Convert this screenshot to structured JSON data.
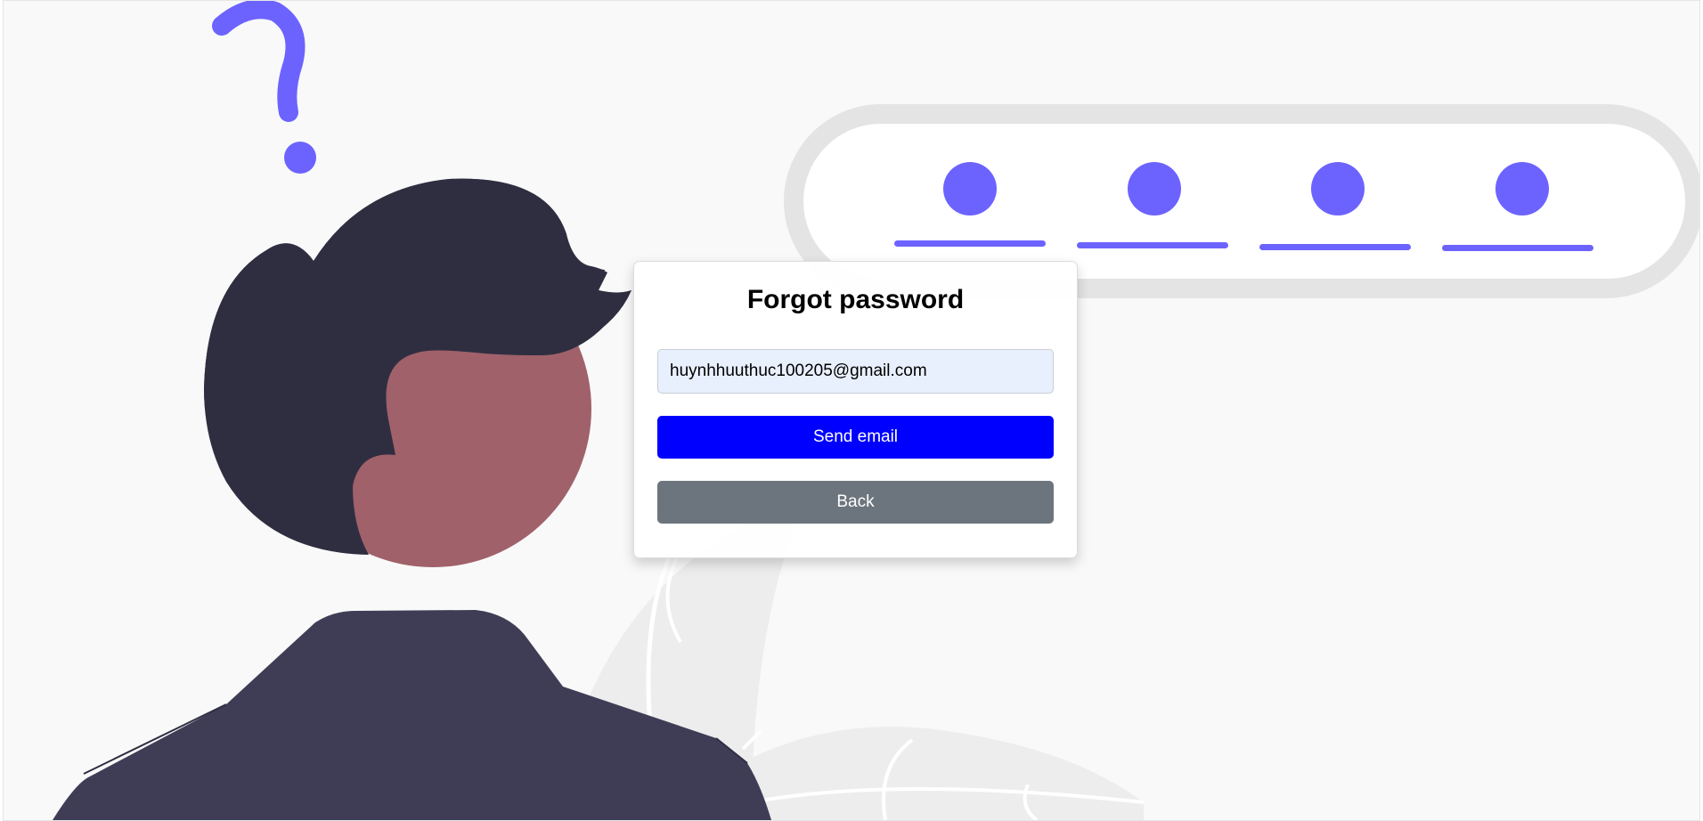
{
  "dialog": {
    "title": "Forgot password",
    "email_value": "huynhhuuthuc100205@gmail.com",
    "send_label": "Send email",
    "back_label": "Back"
  },
  "colors": {
    "accent": "#6c63ff",
    "send_button": "#0000ff",
    "back_button": "#6c757d",
    "hair": "#2f2e41",
    "jacket": "#3f3d56",
    "skin": "#a0616a"
  },
  "illustration": {
    "icons": [
      "question-mark-icon",
      "password-dots-icon",
      "person-illustration",
      "leaf-decoration"
    ],
    "password_dot_count": 4
  }
}
